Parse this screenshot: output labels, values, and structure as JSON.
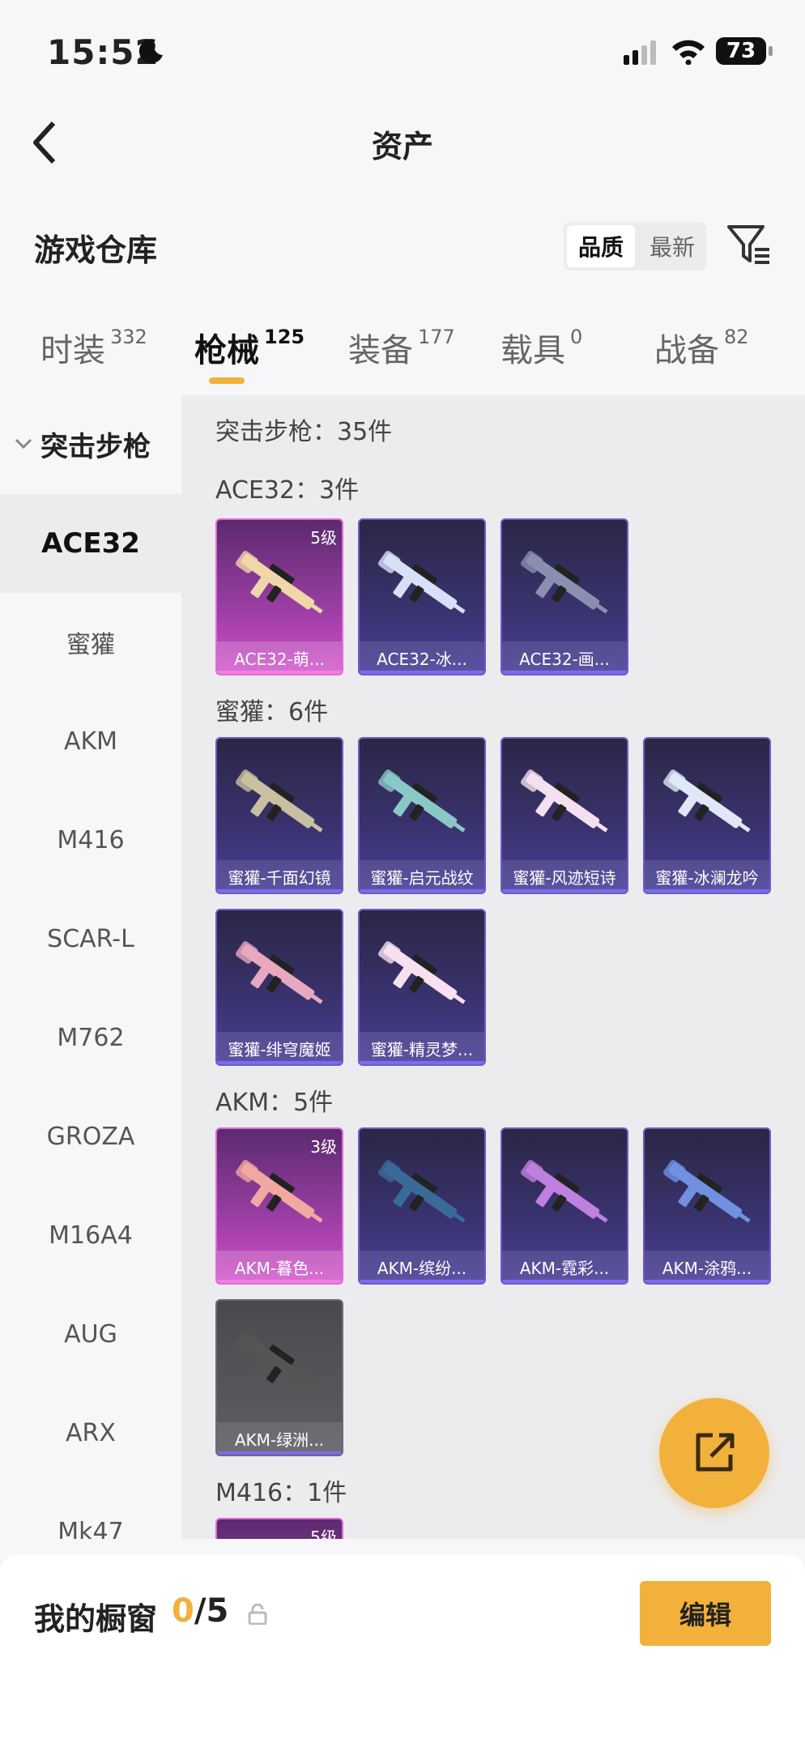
{
  "status": {
    "time": "15:52",
    "battery": "73"
  },
  "nav": {
    "title": "资产"
  },
  "warehouse": {
    "title": "游戏仓库",
    "sort_quality": "品质",
    "sort_latest": "最新"
  },
  "tabs": [
    {
      "label": "时装",
      "count": "332"
    },
    {
      "label": "枪械",
      "count": "125"
    },
    {
      "label": "装备",
      "count": "177"
    },
    {
      "label": "载具",
      "count": "0"
    },
    {
      "label": "战备",
      "count": "82"
    }
  ],
  "sidebar": {
    "category": "突击步枪",
    "items": [
      "ACE32",
      "蜜獾",
      "AKM",
      "M416",
      "SCAR-L",
      "M762",
      "GROZA",
      "M16A4",
      "AUG",
      "ARX",
      "Mk47"
    ]
  },
  "content": {
    "category_total": "突击步枪：35件",
    "sections": [
      {
        "label": "ACE32：3件",
        "items": [
          {
            "name": "ACE32-萌...",
            "level": "5级",
            "rarity": "pink"
          },
          {
            "name": "ACE32-冰...",
            "level": "",
            "rarity": "purple"
          },
          {
            "name": "ACE32-画...",
            "level": "",
            "rarity": "purple"
          }
        ]
      },
      {
        "label": "蜜獾：6件",
        "items": [
          {
            "name": "蜜獾-千面幻镜",
            "level": "",
            "rarity": "purple"
          },
          {
            "name": "蜜獾-启元战纹",
            "level": "",
            "rarity": "purple"
          },
          {
            "name": "蜜獾-风迹短诗",
            "level": "",
            "rarity": "purple"
          },
          {
            "name": "蜜獾-冰澜龙吟",
            "level": "",
            "rarity": "purple"
          },
          {
            "name": "蜜獾-绯穹魔姬",
            "level": "",
            "rarity": "purple"
          },
          {
            "name": "蜜獾-精灵梦...",
            "level": "",
            "rarity": "purple"
          }
        ]
      },
      {
        "label": "AKM：5件",
        "items": [
          {
            "name": "AKM-暮色...",
            "level": "3级",
            "rarity": "pink"
          },
          {
            "name": "AKM-缤纷...",
            "level": "",
            "rarity": "purple"
          },
          {
            "name": "AKM-霓彩...",
            "level": "",
            "rarity": "purple"
          },
          {
            "name": "AKM-涂鸦...",
            "level": "",
            "rarity": "purple"
          },
          {
            "name": "AKM-绿洲...",
            "level": "",
            "rarity": "gray"
          }
        ]
      },
      {
        "label": "M416：1件",
        "items": [
          {
            "name": "",
            "level": "5级",
            "rarity": "pink"
          }
        ]
      }
    ]
  },
  "showcase": {
    "title": "我的橱窗",
    "current": "0",
    "max": "/5",
    "edit_label": "编辑"
  },
  "colors": {
    "accent": "#f2b13b",
    "purple": "#3a3370",
    "pink": "#d24fc9"
  }
}
